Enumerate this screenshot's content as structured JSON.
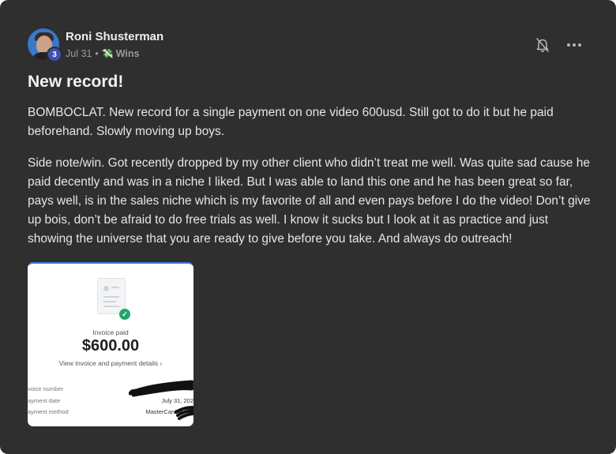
{
  "post": {
    "author": "Roni Shusterman",
    "level": "3",
    "date": "Jul 31",
    "separator": "•",
    "category_emoji": "💸",
    "category": "Wins",
    "title": "New record!",
    "paragraphs": [
      "BOMBOCLAT. New record for a single payment on one video 600usd. Still got to do it but he paid beforehand. Slowly moving up boys.",
      "Side note/win. Got recently dropped by my other client who didn’t treat me well. Was quite sad cause he paid decently and was in a niche I liked. But I was able to land this one and he has been great so far, pays well, is in the sales niche which is my favorite of all and even pays before I do the video! Don’t give up bois, don’t be afraid to do free trials as well. I know it sucks but I look at it as practice and just showing the universe that you are ready to give before you take. And always do outreach!"
    ],
    "icons": [
      "bell-off-icon",
      "more-horizontal-icon"
    ]
  },
  "attachment": {
    "status": "Invoice paid",
    "amount": "$600.00",
    "link": "View invoice and payment details ›",
    "rows": [
      {
        "label": "voice number",
        "value": ""
      },
      {
        "label": "ayment date",
        "value": "July 31, 202"
      },
      {
        "label": "ayment method",
        "value": "MasterCard ••"
      }
    ],
    "check_mark": "✓"
  },
  "colors": {
    "card_bg": "#2f2f2f",
    "text": "#e6e6e6",
    "muted": "#9a9a9a",
    "badge": "#3f4fb5",
    "success": "#24a66b"
  }
}
